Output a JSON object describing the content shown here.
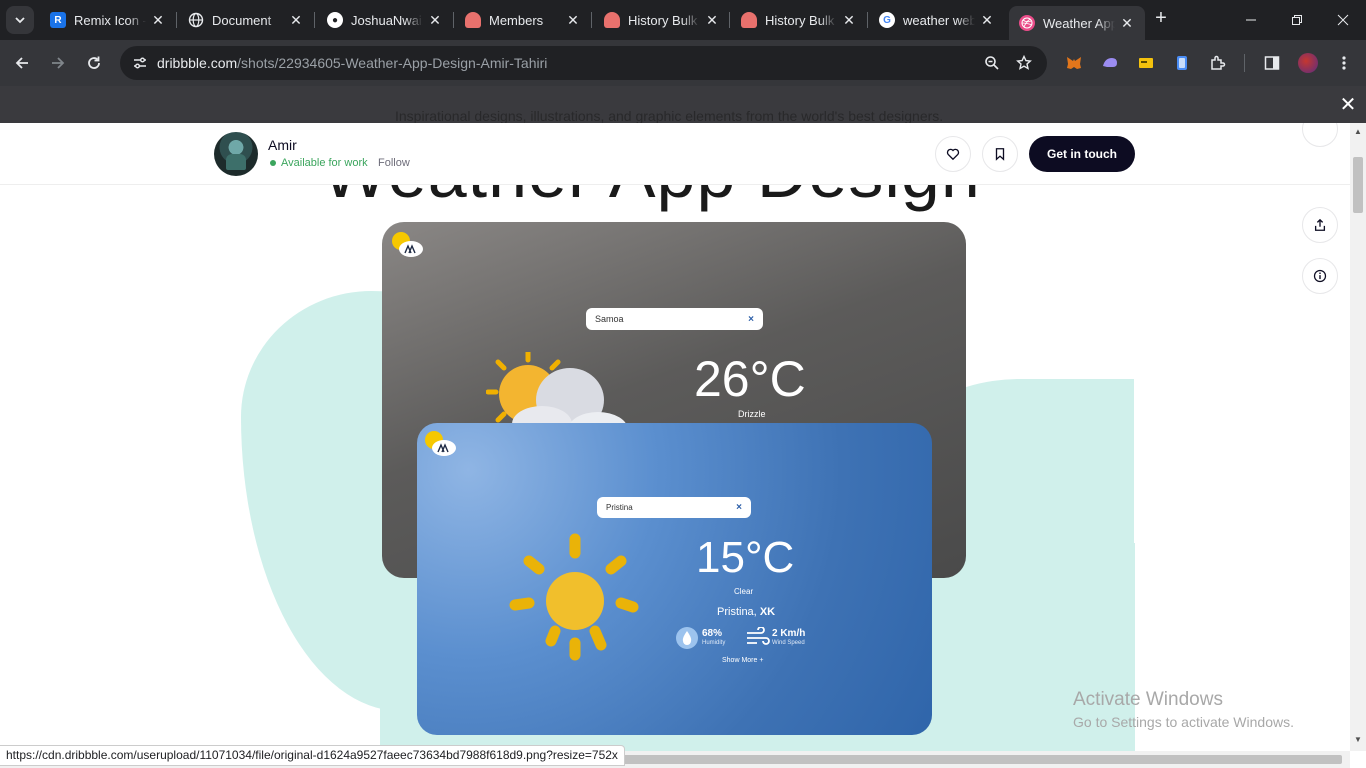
{
  "tabs": [
    {
      "title": "Remix Icon - Open source",
      "favicon": "remix-icon",
      "color": "#1a73e8"
    },
    {
      "title": "Document",
      "favicon": "globe-icon",
      "color": "#9aa0a6"
    },
    {
      "title": "JoshuaNwaiz",
      "favicon": "github-icon",
      "color": "#ffffff"
    },
    {
      "title": "Members",
      "favicon": "bulk-icon",
      "color": "#e8716d"
    },
    {
      "title": "History Bulk",
      "favicon": "bulk-icon",
      "color": "#e8716d"
    },
    {
      "title": "History Bulk",
      "favicon": "bulk-icon",
      "color": "#e8716d"
    },
    {
      "title": "weather web",
      "favicon": "google-icon",
      "color": "#4285f4"
    },
    {
      "title": "Weather App",
      "favicon": "dribbble-icon",
      "color": "#ea4c89",
      "active": true
    }
  ],
  "address": {
    "host": "dribbble.com",
    "path": "/shots/22934605-Weather-App-Design-Amir-Tahiri"
  },
  "overlay": {
    "tagline": "Inspirational designs, illustrations, and graphic elements from the world's best designers."
  },
  "shot": {
    "title": "Weather App Design",
    "author": "Amir",
    "availability": "Available for work",
    "follow_label": "Follow",
    "cta_label": "Get in touch"
  },
  "dark_card": {
    "search": "Samoa",
    "clear_symbol": "×",
    "temperature": "26°C",
    "condition": "Drizzle"
  },
  "blue_card": {
    "search": "Pristina",
    "clear_symbol": "×",
    "temperature": "15°C",
    "condition": "Clear",
    "city": "Pristina,",
    "country": "XK",
    "humidity": "68%",
    "humidity_label": "Humidity",
    "wind": "2 Km/h",
    "wind_label": "Wind Speed",
    "show_more": "Show More +"
  },
  "status_url": "https://cdn.dribbble.com/userupload/11071034/file/original-d1624a9527faeec73634bd7988f618d9.png?resize=752x",
  "watermark": {
    "line1": "Activate Windows",
    "line2": "Go to Settings to activate Windows."
  },
  "colors": {
    "accent_dark": "#0d0c22",
    "available_green": "#3ba55d",
    "blob_mint": "#d0f0eb",
    "card_blue": "#3e72b4"
  }
}
